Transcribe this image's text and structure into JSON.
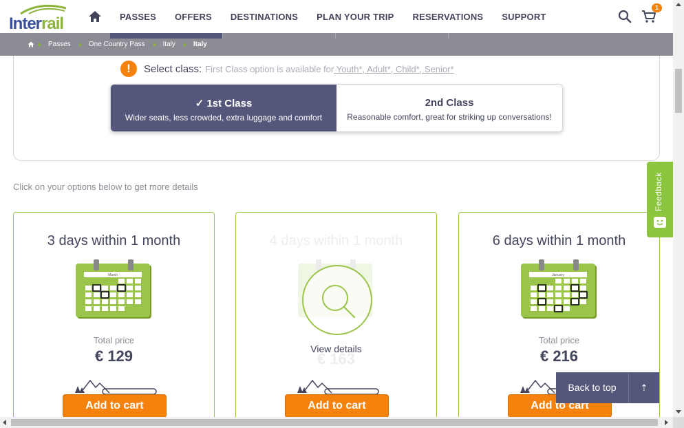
{
  "header": {
    "logo_text_a": "Inter",
    "logo_text_b": "rail",
    "nav": [
      "PASSES",
      "OFFERS",
      "DESTINATIONS",
      "PLAN YOUR TRIP",
      "RESERVATIONS",
      "SUPPORT"
    ],
    "cart_count": "1"
  },
  "breadcrumb": {
    "items": [
      "Passes",
      "One Country Pass",
      "Italy",
      "Italy"
    ]
  },
  "class_select": {
    "label": "Select class:",
    "note_prefix": "First Class option is available for",
    "note_link": " Youth*, Adult*, Child*, Senior*",
    "options": [
      {
        "title": "1st Class",
        "desc": "Wider seats, less crowded, extra luggage and comfort",
        "selected": true
      },
      {
        "title": "2nd Class",
        "desc": "Reasonable comfort, great for striking up conversations!",
        "selected": false
      }
    ]
  },
  "hint": "Click on your options below to get more details",
  "cards": [
    {
      "title": "3 days within 1 month",
      "price_label": "Total price",
      "price": "€ 129",
      "button": "Add to cart",
      "cal_month": "March"
    },
    {
      "title": "4 days within 1 month",
      "price_label": "",
      "price": "€ 163",
      "button": "Add to cart",
      "view_label": "View details"
    },
    {
      "title": "6 days within 1 month",
      "price_label": "Total price",
      "price": "€ 216",
      "button": "Add to cart",
      "cal_month": "January"
    }
  ],
  "feedback_label": "Feedback",
  "back_to_top_label": "Back to top",
  "colors": {
    "brand_blue": "#3a4f9b",
    "brand_green": "#8cb33a",
    "accent_orange": "#f5820d",
    "selected_purple": "#54577a",
    "feedback_green": "#8cc63f"
  }
}
